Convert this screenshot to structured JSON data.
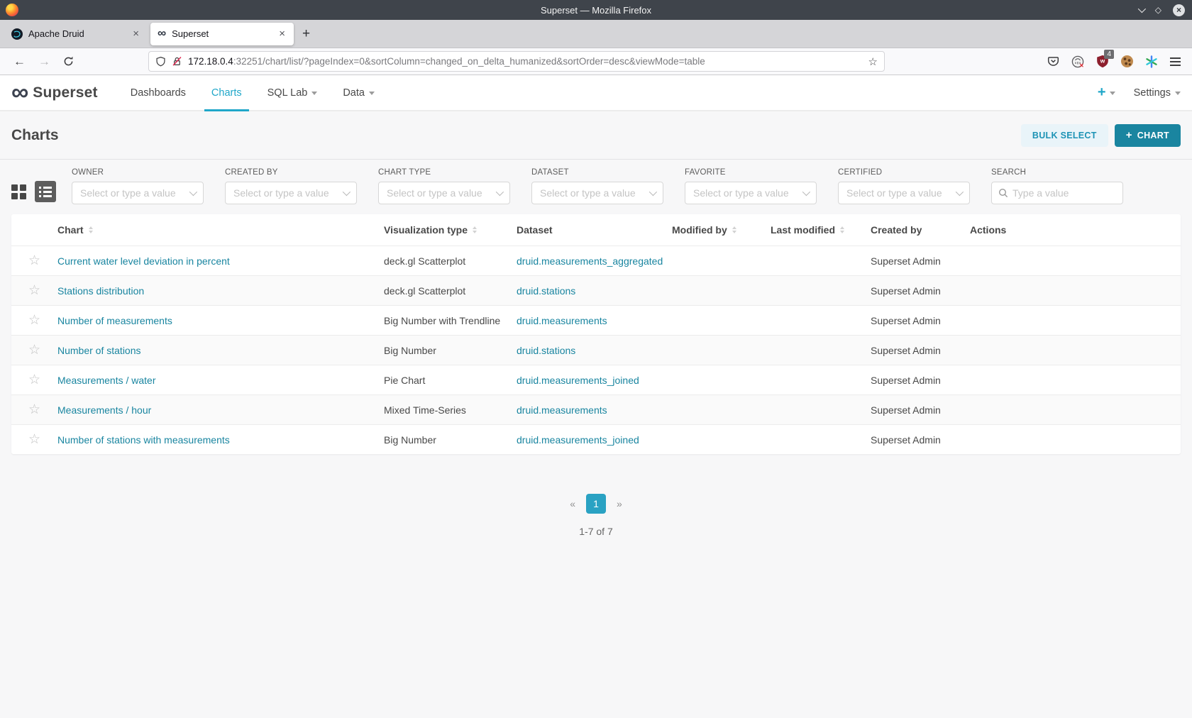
{
  "window": {
    "title": "Superset — Mozilla Firefox"
  },
  "browser": {
    "tabs": [
      {
        "title": "Apache Druid",
        "close": "×"
      },
      {
        "title": "Superset",
        "close": "×"
      }
    ],
    "new_tab": "+",
    "back": "←",
    "forward": "→",
    "url_host": "172.18.0.4",
    "url_rest": ":32251/chart/list/?pageIndex=0&sortColumn=changed_on_delta_humanized&sortOrder=desc&viewMode=table",
    "bookmark_star": "☆",
    "adblock_badge": "4",
    "adblock_letter": "w"
  },
  "nav": {
    "logo_glyph": "∞",
    "brand": "Superset",
    "items": [
      {
        "label": "Dashboards"
      },
      {
        "label": "Charts"
      },
      {
        "label": "SQL Lab"
      },
      {
        "label": "Data"
      }
    ],
    "plus": "+",
    "settings": "Settings"
  },
  "page": {
    "title": "Charts",
    "bulk_select": "BULK SELECT",
    "chart_button_plus": "+",
    "chart_button": "CHART"
  },
  "filters": [
    {
      "label": "OWNER",
      "placeholder": "Select or type a value"
    },
    {
      "label": "CREATED BY",
      "placeholder": "Select or type a value"
    },
    {
      "label": "CHART TYPE",
      "placeholder": "Select or type a value"
    },
    {
      "label": "DATASET",
      "placeholder": "Select or type a value"
    },
    {
      "label": "FAVORITE",
      "placeholder": "Select or type a value"
    },
    {
      "label": "CERTIFIED",
      "placeholder": "Select or type a value"
    },
    {
      "label": "SEARCH",
      "placeholder": "Type a value"
    }
  ],
  "table": {
    "columns": [
      {
        "label": "Chart",
        "sortable": true
      },
      {
        "label": "Visualization type",
        "sortable": true
      },
      {
        "label": "Dataset",
        "sortable": false
      },
      {
        "label": "Modified by",
        "sortable": true
      },
      {
        "label": "Last modified",
        "sortable": true
      },
      {
        "label": "Created by",
        "sortable": false
      },
      {
        "label": "Actions",
        "sortable": false
      }
    ],
    "star_glyph": "☆",
    "rows": [
      {
        "chart": "Current water level deviation in percent",
        "viz_type": "deck.gl Scatterplot",
        "dataset": "druid.measurements_aggregated",
        "modified_by": "",
        "last_modified": "",
        "created_by": "Superset Admin"
      },
      {
        "chart": "Stations distribution",
        "viz_type": "deck.gl Scatterplot",
        "dataset": "druid.stations",
        "modified_by": "",
        "last_modified": "",
        "created_by": "Superset Admin"
      },
      {
        "chart": "Number of measurements",
        "viz_type": "Big Number with Trendline",
        "dataset": "druid.measurements",
        "modified_by": "",
        "last_modified": "",
        "created_by": "Superset Admin"
      },
      {
        "chart": "Number of stations",
        "viz_type": "Big Number",
        "dataset": "druid.stations",
        "modified_by": "",
        "last_modified": "",
        "created_by": "Superset Admin"
      },
      {
        "chart": "Measurements / water",
        "viz_type": "Pie Chart",
        "dataset": "druid.measurements_joined",
        "modified_by": "",
        "last_modified": "",
        "created_by": "Superset Admin"
      },
      {
        "chart": "Measurements / hour",
        "viz_type": "Mixed Time-Series",
        "dataset": "druid.measurements",
        "modified_by": "",
        "last_modified": "",
        "created_by": "Superset Admin"
      },
      {
        "chart": "Number of stations with measurements",
        "viz_type": "Big Number",
        "dataset": "druid.measurements_joined",
        "modified_by": "",
        "last_modified": "",
        "created_by": "Superset Admin"
      }
    ]
  },
  "pagination": {
    "prev": "«",
    "page": "1",
    "next": "»",
    "summary": "1-7 of 7"
  },
  "colors": {
    "primary": "#20a7c9",
    "link": "#1985a0",
    "primary_button_bg": "#1a85a0",
    "titlebar_bg": "#3f444b"
  }
}
